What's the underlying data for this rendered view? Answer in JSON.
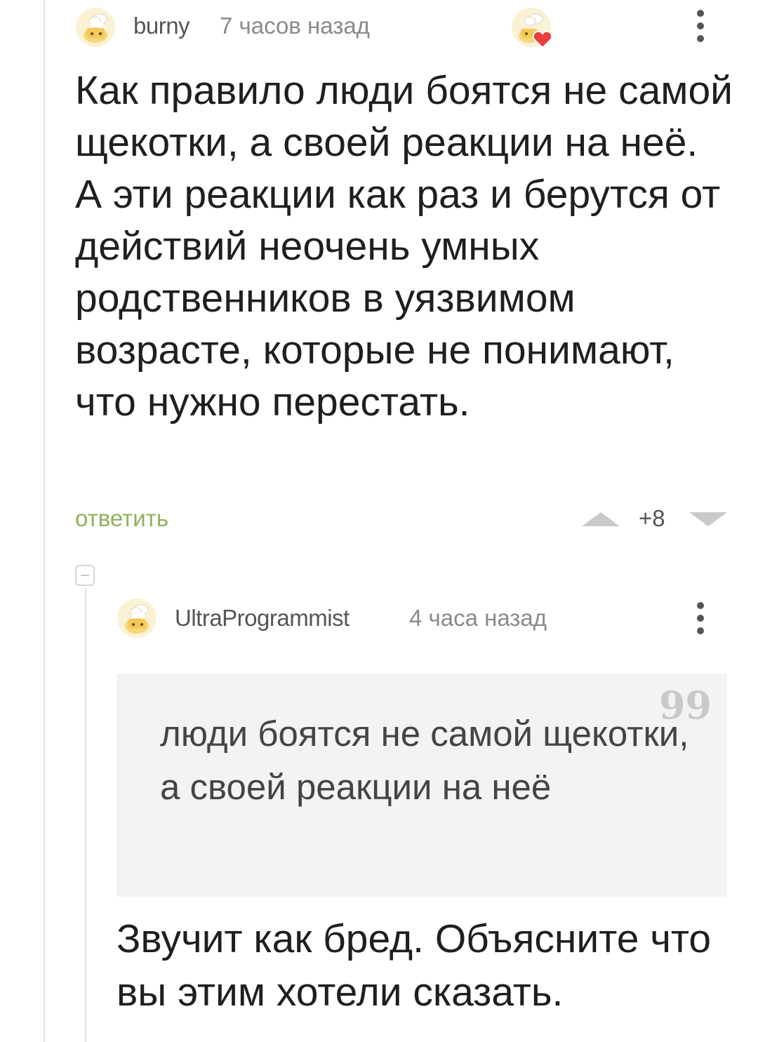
{
  "comment": {
    "author": "burny",
    "time": "7 часов назад",
    "text": "Как правило люди боятся не самой щекотки, а своей реакции на неё. А эти реакции как раз и берутся от действий неочень умных родственников в уязвимом возрасте, которые не понимают, что нужно перестать.",
    "reply_label": "ответить",
    "rating": "+8",
    "avatar_icon": "cook-avatar-icon",
    "badge_icon": "cook-heart-badge-icon"
  },
  "reply": {
    "author": "UltraProgrammist",
    "time": "4 часа назад",
    "quote_mark": "99",
    "quote": "люди боятся не самой щекотки, а своей реакции на неё",
    "text": "Звучит как бред. Объясните что вы этим хотели сказать.",
    "avatar_icon": "cook-avatar-icon"
  },
  "colors": {
    "accent_green": "#8fb15d",
    "heart_red": "#e8403d",
    "avatar_yellow": "#f6d77a"
  }
}
